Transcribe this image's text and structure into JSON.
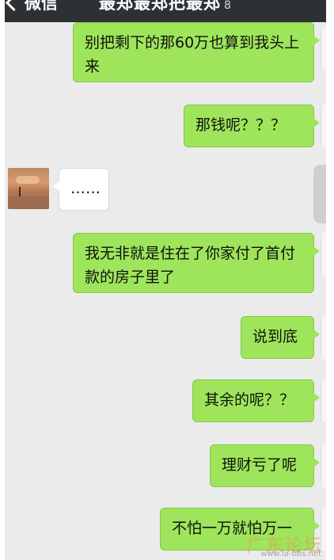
{
  "header": {
    "back_label": "微信",
    "title": "最郑最郑把最郑",
    "title_suffix": "8"
  },
  "messages": [
    {
      "side": "out",
      "text": "别把剩下的那60万也算到我头上来"
    },
    {
      "side": "out",
      "text": "那钱呢？？？"
    },
    {
      "side": "in",
      "text": "……"
    },
    {
      "side": "out",
      "text": "我无非就是住在了你家付了首付款的房子里了"
    },
    {
      "side": "out",
      "text": "说到底"
    },
    {
      "side": "out",
      "text": "其余的呢？？"
    },
    {
      "side": "out",
      "text": "理财亏了呢"
    },
    {
      "side": "out",
      "text": "不怕一万就怕万一"
    }
  ],
  "watermark": {
    "text": "广东论坛",
    "url": "www.la-bbs.net"
  },
  "colors": {
    "navbar": "#2e3134",
    "chat_bg": "#ebebeb",
    "out_bubble": "#9ee55b",
    "in_bubble": "#ffffff"
  }
}
